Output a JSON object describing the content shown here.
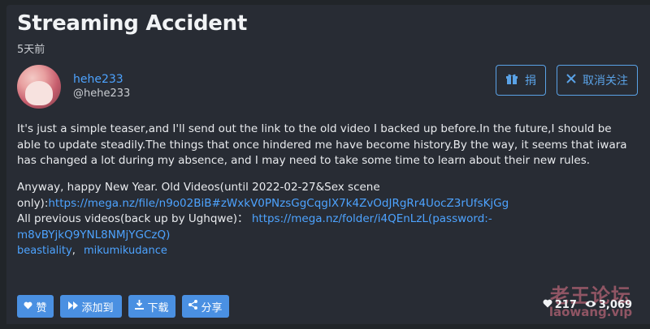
{
  "post": {
    "title": "Streaming Accident",
    "date": "5天前"
  },
  "author": {
    "username": "hehe233",
    "handle": "@hehe233"
  },
  "actions": {
    "gift_label": "捐",
    "unfollow_label": "取消关注"
  },
  "content": {
    "paragraph1": "It's just a simple teaser,and I'll send out the link to the old video I backed up before.In the future,I should be able to update steadily.The things that once hindered me have become history.By the way, it seems that iwara has changed a lot during my absence, and I may need to take some time to learn about their new rules.",
    "line2a": "Anyway, happy New Year. Old Videos(until 2022-02-27&Sex scene only):",
    "link1": "https://mega.nz/file/n9o02BiB#zWxkV0PNzsGgCqgIX7k4ZvOdJRgRr4UocZ3rUfsKjGg",
    "line3a": "All previous videos(back up by Ughqwe)：",
    "link2": "https://mega.nz/folder/i4QEnLzL(password:-m8vBYjkQ9YNL8NMjYGCzQ)"
  },
  "tags": [
    "beastiality",
    "mikumikudance"
  ],
  "tag_separator": ",",
  "bottom": {
    "like_label": "赞",
    "add_label": "添加到",
    "download_label": "下载",
    "share_label": "分享",
    "likes": "217",
    "views": "3,069"
  },
  "watermark": {
    "line1": "老王论坛",
    "line2": "laowang.vip"
  },
  "colors": {
    "background": "#212529",
    "panel": "#282c34",
    "accent": "#4a90e2",
    "link": "#4da3ff"
  },
  "icons": [
    "gift-icon",
    "close-icon",
    "heart-icon",
    "fast-forward-icon",
    "download-icon",
    "share-icon",
    "eye-icon"
  ]
}
